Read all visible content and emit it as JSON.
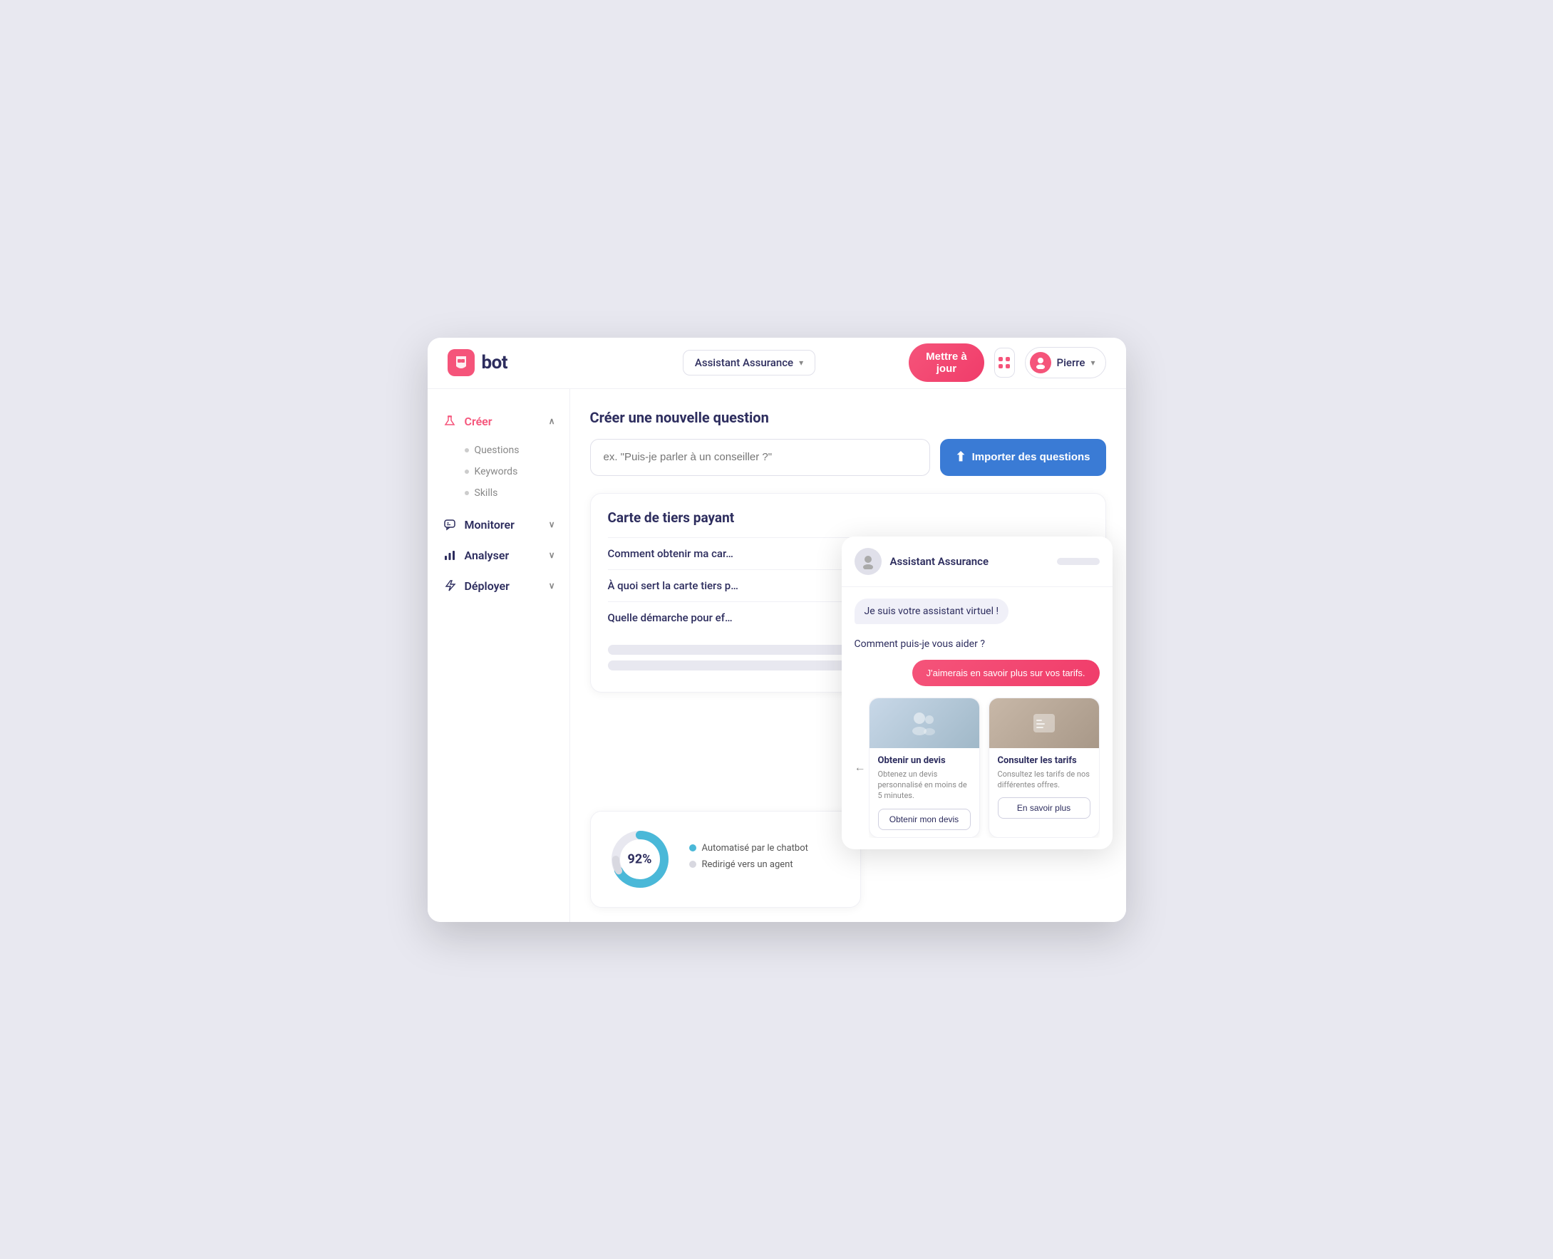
{
  "header": {
    "logo_text": "bot",
    "assistant_selector": {
      "label": "Assistant Assurance",
      "chevron": "▾"
    },
    "update_button": "Mettre à jour",
    "user": {
      "name": "Pierre",
      "chevron": "▾"
    }
  },
  "sidebar": {
    "items": [
      {
        "id": "creer",
        "label": "Créer",
        "icon": "flask",
        "active": true,
        "expanded": true,
        "chevron": "∧"
      },
      {
        "id": "monitorer",
        "label": "Monitorer",
        "icon": "chat",
        "active": false,
        "expanded": false,
        "chevron": "∨"
      },
      {
        "id": "analyser",
        "label": "Analyser",
        "icon": "bar-chart",
        "active": false,
        "expanded": false,
        "chevron": "∨"
      },
      {
        "id": "deployer",
        "label": "Déployer",
        "icon": "bolt",
        "active": false,
        "expanded": false,
        "chevron": "∨"
      }
    ],
    "sub_items": [
      {
        "label": "Questions"
      },
      {
        "label": "Keywords"
      },
      {
        "label": "Skills"
      }
    ]
  },
  "main": {
    "page_title": "Créer une nouvelle question",
    "question_input_placeholder": "ex. \"Puis-je parler à un conseiller ?\"",
    "import_button": "Importer des questions",
    "question_card": {
      "title": "Carte de tiers payant",
      "questions": [
        "Comment obtenir ma car…",
        "À quoi sert la carte tiers p…",
        "Quelle démarche pour ef…"
      ]
    },
    "stats": {
      "percentage": "92%",
      "legend": [
        {
          "label": "Automatisé par le chatbot",
          "color": "#4ab8d8"
        },
        {
          "label": "Redirigé vers un agent",
          "color": "#d8d8e0"
        }
      ]
    }
  },
  "chatbot": {
    "assistant_name": "Assistant Assurance",
    "bubble_1": "Je suis votre assistant virtuel !",
    "question_1": "Comment puis-je vous aider ?",
    "user_message": "J'aimerais en savoir plus sur vos tarifs.",
    "cards": [
      {
        "id": "devis",
        "title": "Obtenir un devis",
        "description": "Obtenez un devis personnalisé en moins de 5 minutes.",
        "button_label": "Obtenir mon devis",
        "img_hint": "business-people"
      },
      {
        "id": "tarifs",
        "title": "Consulter les tarifs",
        "description": "Consultez les tarifs de nos différentes offres.",
        "button_label": "En savoir plus",
        "img_hint": "calculator"
      }
    ]
  }
}
